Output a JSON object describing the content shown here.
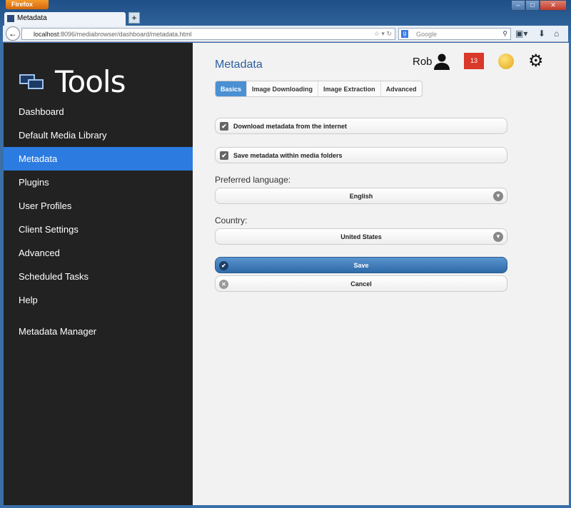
{
  "browser": {
    "menu": "Firefox",
    "tab_title": "Metadata",
    "new_tab": "+",
    "url_host": "localhost",
    "url_path": ":8096/mediabrowser/dashboard/metadata.html",
    "search_placeholder": "Google"
  },
  "sidebar": {
    "title": "Tools",
    "items": [
      {
        "label": "Dashboard"
      },
      {
        "label": "Default Media Library"
      },
      {
        "label": "Metadata",
        "active": true
      },
      {
        "label": "Plugins"
      },
      {
        "label": "User Profiles"
      },
      {
        "label": "Client Settings"
      },
      {
        "label": "Advanced"
      },
      {
        "label": "Scheduled Tasks"
      },
      {
        "label": "Help"
      },
      {
        "label": "Metadata Manager"
      }
    ]
  },
  "header": {
    "title": "Metadata",
    "user": "Rob",
    "notifications": "13"
  },
  "tabs": [
    {
      "label": "Basics",
      "active": true
    },
    {
      "label": "Image Downloading"
    },
    {
      "label": "Image Extraction"
    },
    {
      "label": "Advanced"
    }
  ],
  "form": {
    "download_label": "Download metadata from the internet",
    "download_checked": true,
    "save_label": "Save metadata within media folders",
    "save_checked": true,
    "language_label": "Preferred language:",
    "language_value": "English",
    "country_label": "Country:",
    "country_value": "United States",
    "save_button": "Save",
    "cancel_button": "Cancel"
  },
  "colors": {
    "accent": "#2c7be0",
    "sidebar": "#222222",
    "title": "#2b5f9e",
    "badge": "#d9382a"
  }
}
